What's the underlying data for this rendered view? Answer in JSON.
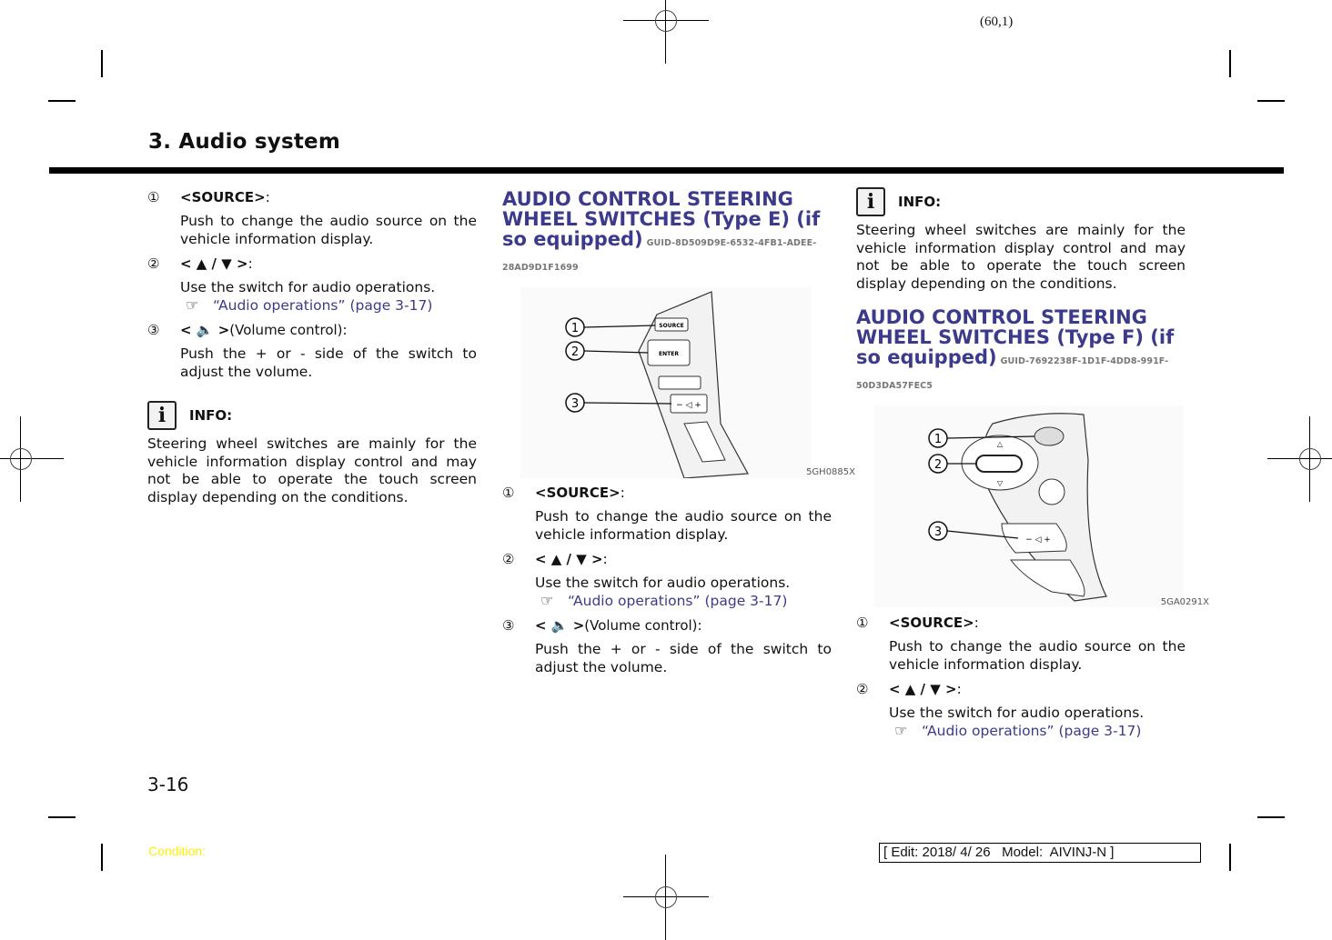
{
  "page_ref": "(60,1)",
  "section_title": "3. Audio system",
  "column1": {
    "items": [
      {
        "num": "①",
        "label": "<SOURCE>",
        "suffix": ":",
        "body": "Push to change the audio source on the vehicle information display."
      },
      {
        "num": "②",
        "label": "< ▲ / ▼ >",
        "suffix": ":",
        "body": "Use the switch for audio operations.",
        "link": "“Audio operations” (page 3-17)"
      },
      {
        "num": "③",
        "label": "< 🔈 >",
        "suffix": " (Volume control):",
        "body": "Push the + or - side of the switch to adjust the volume."
      }
    ],
    "info": {
      "icon": "info-icon",
      "label": "INFO:",
      "text": "Steering wheel switches are mainly for the vehicle information display control and may not be able to operate the touch screen display depending on the conditions."
    }
  },
  "column2": {
    "heading": "AUDIO CONTROL STEERING WHEEL SWITCHES (Type E) (if so equipped)",
    "guid": "GUID-8D509D9E-6532-4FB1-ADEE-28AD9D1F1699",
    "figure": {
      "code": "5GH0885X",
      "callouts": [
        "①",
        "②",
        "③"
      ],
      "button_labels": [
        "SOURCE",
        "ENTER"
      ]
    },
    "items": [
      {
        "num": "①",
        "label": "<SOURCE>",
        "suffix": ":",
        "body": "Push to change the audio source on the vehicle information display."
      },
      {
        "num": "②",
        "label": "< ▲ / ▼ >",
        "suffix": ":",
        "body": "Use the switch for audio operations.",
        "link": "“Audio operations” (page 3-17)"
      },
      {
        "num": "③",
        "label": "< 🔈 >",
        "suffix": " (Volume control):",
        "body": "Push the + or - side of the switch to adjust the volume."
      }
    ]
  },
  "column3": {
    "info": {
      "icon": "info-icon",
      "label": "INFO:",
      "text": "Steering wheel switches are mainly for the vehicle information display control and may not be able to operate the touch screen display depending on the conditions."
    },
    "heading": "AUDIO CONTROL STEERING WHEEL SWITCHES (Type F) (if so equipped)",
    "guid": "GUID-7692238F-1D1F-4DD8-991F-50D3DA57FEC5",
    "figure": {
      "code": "5GA0291X",
      "callouts": [
        "①",
        "②",
        "③"
      ]
    },
    "items": [
      {
        "num": "①",
        "label": "<SOURCE>",
        "suffix": ":",
        "body": "Push to change the audio source on the vehicle information display."
      },
      {
        "num": "②",
        "label": "< ▲ / ▼ >",
        "suffix": ":",
        "body": "Use the switch for audio operations.",
        "link": "“Audio operations” (page 3-17)"
      }
    ]
  },
  "footer": {
    "page_number": "3-16",
    "condition": "Condition:",
    "edit_info": "[ Edit: 2018/ 4/ 26   Model:  AIVINJ-N ]"
  },
  "colors": {
    "heading": "#3c3a8a",
    "link": "#3c3a8a",
    "condition": "#ffee00"
  }
}
